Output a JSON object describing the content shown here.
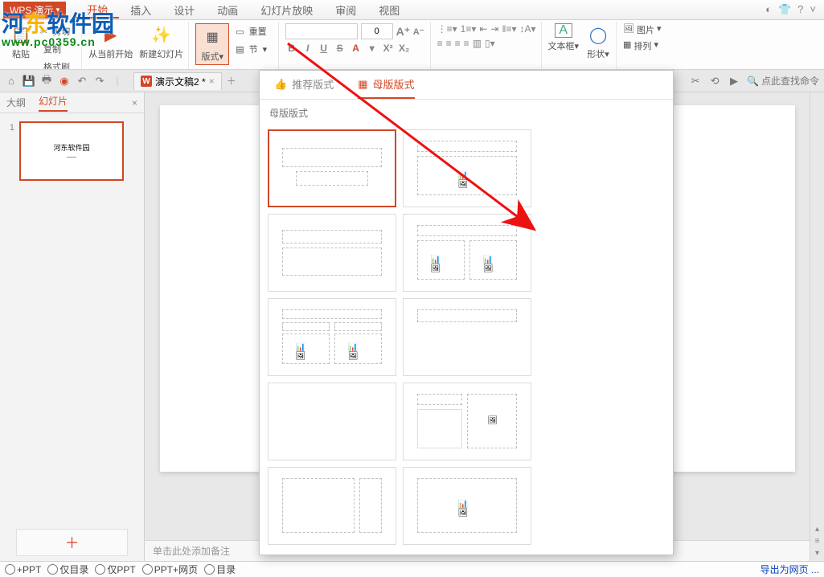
{
  "watermark": {
    "brand": "河东软件园",
    "url": "www.pc0359.cn"
  },
  "app": {
    "name": "WPS 演示"
  },
  "menu": {
    "tabs": [
      "开始",
      "插入",
      "设计",
      "动画",
      "幻灯片放映",
      "审阅",
      "视图"
    ],
    "active": 0
  },
  "ribbon": {
    "clipboard": {
      "cut": "剪切",
      "copy": "复制",
      "fmtpaint": "格式刷",
      "paste": "粘贴"
    },
    "slides": {
      "from_current": "从当前开始",
      "new_slide": "新建幻灯片"
    },
    "layout": {
      "label": "版式",
      "reset": "重置",
      "section": "节"
    },
    "font": {
      "name": "",
      "size": "0",
      "grow": "A",
      "shrink": "A"
    },
    "textbox": "文本框",
    "shapes": "形状",
    "picture": "图片",
    "arrange": "排列"
  },
  "qa": {
    "doc_title": "演示文稿2 *",
    "search_cmd": "点此查找命令"
  },
  "left": {
    "tabs": {
      "outline": "大纲",
      "slides": "幻灯片"
    },
    "slide1": {
      "num": "1",
      "title": "河东软件园",
      "sub": "——"
    }
  },
  "notes": {
    "placeholder": "单击此处添加备注"
  },
  "layout_popup": {
    "recommended": "推荐版式",
    "master": "母版版式",
    "section": "母版版式"
  },
  "bottom": {
    "opt1": "+PPT",
    "opt2": "仅目录",
    "opt3": "仅PPT",
    "opt4": "PPT+网页",
    "opt5": "目录",
    "export": "导出为网页 ..."
  }
}
